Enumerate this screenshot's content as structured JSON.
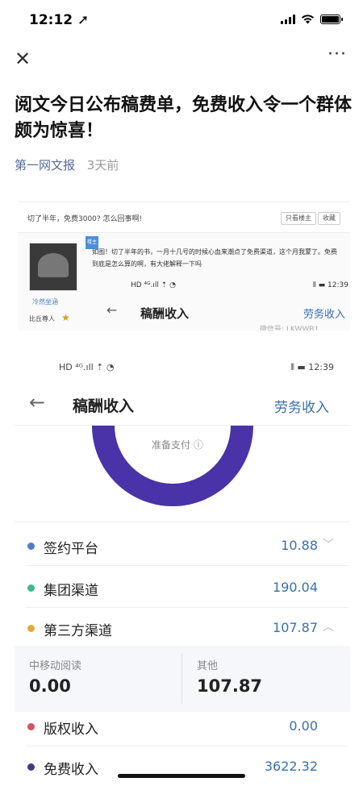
{
  "status_bar": {
    "time": "12:12 ➚"
  },
  "nav": {
    "close": "✕",
    "more": "···"
  },
  "article": {
    "title": "阅文今日公布稿费单，免费收入令一个群体颇为惊喜！",
    "source": "第一网文报",
    "age": "3天前"
  },
  "forum_post": {
    "title": "切了半年，免费3000? 怎么回事啊!",
    "buttons": [
      "只看楼主",
      "收藏"
    ],
    "badge": "楼主",
    "user_name": "冷然坐涵",
    "user_rank": "比丘尊人",
    "body": "如图！切了半年的书，一月十几号的时候心血来潮点了免费渠道，这个月我蒙了。免费到底是怎么算的啊，有大佬解释一下吗",
    "mini_status_left": "HD ⁴ᴳ.ıll ⇡ ◔",
    "mini_status_right": "⫴ ▬ 12:39",
    "mini_title": "稿酬收入",
    "mini_link": "劳务收入",
    "watermark": "微信号: LKWWB1"
  },
  "income": {
    "status_left": "HD ⁴ᴳ.ıll ⇡ ◔",
    "status_right": "⫴ ▬ 12:39",
    "title": "稿酬收入",
    "link": "劳务收入",
    "donut_label": "准备支付 ⓘ",
    "rows_top": [
      {
        "label": "签约平台",
        "value": "10.88",
        "chev": "﹀",
        "color": "#4a7ec8"
      },
      {
        "label": "集团渠道",
        "value": "190.04",
        "chev": "",
        "color": "#3fb98d"
      },
      {
        "label": "第三方渠道",
        "value": "107.87",
        "chev": "︿",
        "color": "#e8a93a"
      }
    ],
    "sub": [
      {
        "key": "中移动阅读",
        "value": "0.00"
      },
      {
        "key": "其他",
        "value": "107.87"
      }
    ],
    "rows_bottom": [
      {
        "label": "版权收入",
        "value": "0.00",
        "color": "#d2526a"
      },
      {
        "label": "免费收入",
        "value": "3622.32",
        "color": "#3d3a8c"
      }
    ],
    "donut_color": "#4a32a8"
  }
}
